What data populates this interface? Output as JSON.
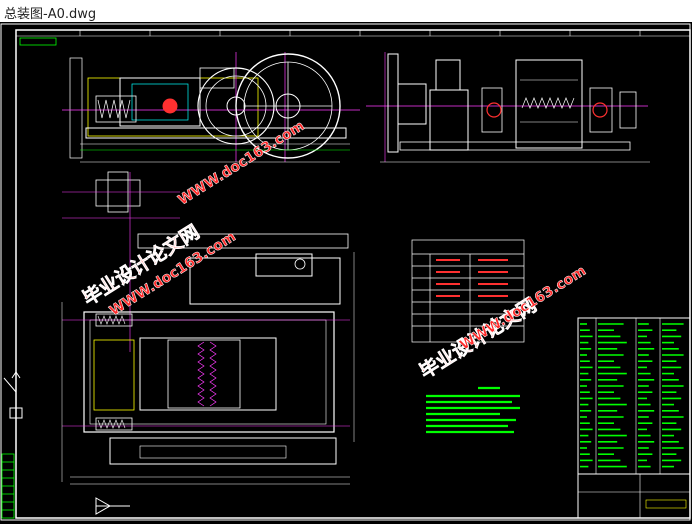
{
  "window": {
    "title": "总装图-A0.dwg"
  },
  "drawing": {
    "background": "#000000",
    "watermarks": [
      {
        "text": "毕业设计论文网",
        "url": "WWW.doc163.com"
      },
      {
        "text": "毕业设计论文网",
        "url": "WWW.doc163.com"
      },
      {
        "text": "毕业设计论文网",
        "url": "WWW.doc163.com"
      }
    ],
    "watermark_color": "#ff2a2a",
    "line_colors": {
      "frame": "#ffffff",
      "magenta": "#ff3cff",
      "green": "#00ff00",
      "yellow": "#ffff00",
      "cyan": "#00ffff",
      "red": "#ff3030"
    },
    "icons": [
      "ucs-axis-icon",
      "north-arrow-icon"
    ]
  }
}
